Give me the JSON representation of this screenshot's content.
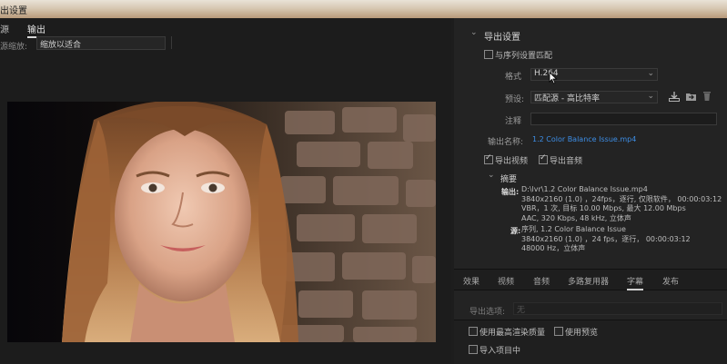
{
  "window": {
    "title": "出设置"
  },
  "tabs": [
    {
      "label": "源"
    },
    {
      "label": "输出"
    }
  ],
  "source_scaling": {
    "label": "源缩放:",
    "value": "缩放以适合"
  },
  "export_settings": {
    "section_title": "导出设置",
    "match_sequence_label": "与序列设置匹配",
    "format_label": "格式",
    "format_value": "H.264",
    "preset_label": "预设:",
    "preset_value": "匹配源 - 高比特率",
    "comment_label": "注释",
    "comment_value": "",
    "output_name_label": "输出名称:",
    "output_name_value": "1.2 Color Balance Issue.mp4",
    "export_video_label": "导出视频",
    "export_audio_label": "导出音频",
    "export_video_checked": true,
    "export_audio_checked": true
  },
  "summary": {
    "title": "摘要",
    "output_label": "输出:",
    "output_lines": [
      "D:\\lvr\\1.2 Color Balance Issue.mp4",
      "3840x2160 (1.0) ，24fps，逐行, 仅限软件，  00:00:03:12",
      "VBR，1 次, 目标 10.00  Mbps, 最大 12.00  Mbps",
      "AAC, 320 Kbps, 48  kHz, 立体声"
    ],
    "source_label": "源:",
    "source_lines": [
      "序列, 1.2 Color Balance Issue",
      "3840x2160 (1.0) ，24 fps，逐行，  00:00:03:12",
      "48000 Hz，立体声"
    ]
  },
  "bottom_tabs": [
    {
      "label": "效果"
    },
    {
      "label": "视频"
    },
    {
      "label": "音频"
    },
    {
      "label": "多路复用器"
    },
    {
      "label": "字幕"
    },
    {
      "label": "发布"
    }
  ],
  "export_options": {
    "label": "导出选项:",
    "value": "无"
  },
  "options": {
    "max_render_quality": "使用最高渲染质量",
    "use_previews": "使用预览",
    "import_into_project": "导入项目中"
  }
}
